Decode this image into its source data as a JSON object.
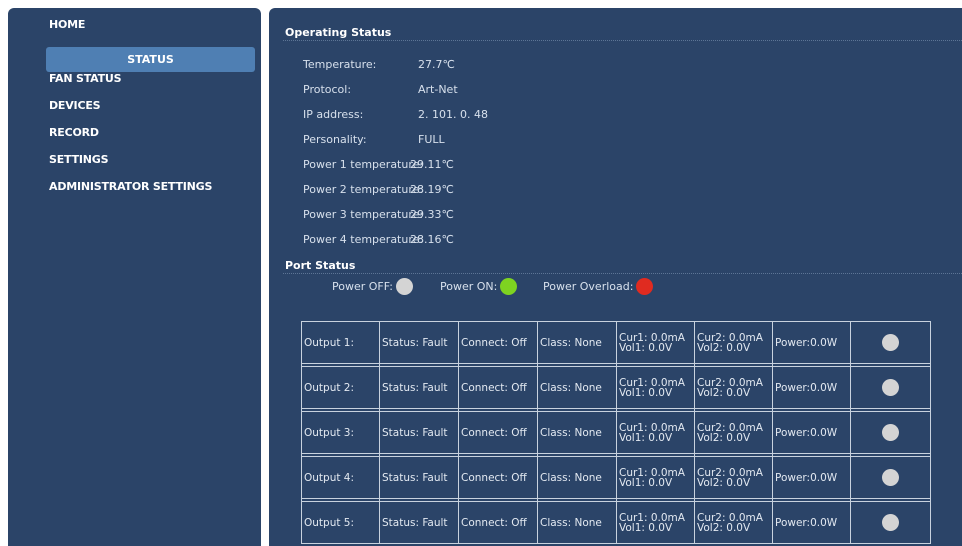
{
  "sidebar": {
    "items": [
      "HOME",
      "STATUS",
      "FAN STATUS",
      "DEVICES",
      "RECORD",
      "SETTINGS",
      "ADMINISTRATOR SETTINGS"
    ],
    "active": "STATUS"
  },
  "operating": {
    "title": "Operating Status",
    "rows": [
      {
        "label": "Temperature:",
        "value": "27.7℃"
      },
      {
        "label": "Protocol:",
        "value": "Art-Net"
      },
      {
        "label": "IP address:",
        "value": "2. 101. 0. 48"
      },
      {
        "label": "Personality:",
        "value": "FULL"
      },
      {
        "label": "Power 1 temperature:",
        "value": "29.11℃"
      },
      {
        "label": "Power 2 temperature:",
        "value": "28.19℃"
      },
      {
        "label": "Power 3 temperature:",
        "value": "29.33℃"
      },
      {
        "label": "Power 4 temperature:",
        "value": "28.16℃"
      }
    ]
  },
  "port": {
    "title": "Port Status",
    "legend": [
      {
        "label": "Power OFF:",
        "color": "#d4d4d4"
      },
      {
        "label": "Power ON:",
        "color": "#7ed321"
      },
      {
        "label": "Power Overload:",
        "color": "#e02b20"
      }
    ],
    "rows": [
      {
        "output": "Output 1:",
        "status": "Status: Fault",
        "connect": "Connect: Off",
        "class": "Class: None",
        "cur1": "Cur1: 0.0mA",
        "vol1": "Vol1: 0.0V",
        "cur2": "Cur2: 0.0mA",
        "vol2": "Vol2: 0.0V",
        "power": "Power:0.0W",
        "state_color": "#d4d4d4"
      },
      {
        "output": "Output 2:",
        "status": "Status: Fault",
        "connect": "Connect: Off",
        "class": "Class: None",
        "cur1": "Cur1: 0.0mA",
        "vol1": "Vol1: 0.0V",
        "cur2": "Cur2: 0.0mA",
        "vol2": "Vol2: 0.0V",
        "power": "Power:0.0W",
        "state_color": "#d4d4d4"
      },
      {
        "output": "Output 3:",
        "status": "Status: Fault",
        "connect": "Connect: Off",
        "class": "Class: None",
        "cur1": "Cur1: 0.0mA",
        "vol1": "Vol1: 0.0V",
        "cur2": "Cur2: 0.0mA",
        "vol2": "Vol2: 0.0V",
        "power": "Power:0.0W",
        "state_color": "#d4d4d4"
      },
      {
        "output": "Output 4:",
        "status": "Status: Fault",
        "connect": "Connect: Off",
        "class": "Class: None",
        "cur1": "Cur1: 0.0mA",
        "vol1": "Vol1: 0.0V",
        "cur2": "Cur2: 0.0mA",
        "vol2": "Vol2: 0.0V",
        "power": "Power:0.0W",
        "state_color": "#d4d4d4"
      },
      {
        "output": "Output 5:",
        "status": "Status: Fault",
        "connect": "Connect: Off",
        "class": "Class: None",
        "cur1": "Cur1: 0.0mA",
        "vol1": "Vol1: 0.0V",
        "cur2": "Cur2: 0.0mA",
        "vol2": "Vol2: 0.0V",
        "power": "Power:0.0W",
        "state_color": "#d4d4d4"
      }
    ]
  }
}
